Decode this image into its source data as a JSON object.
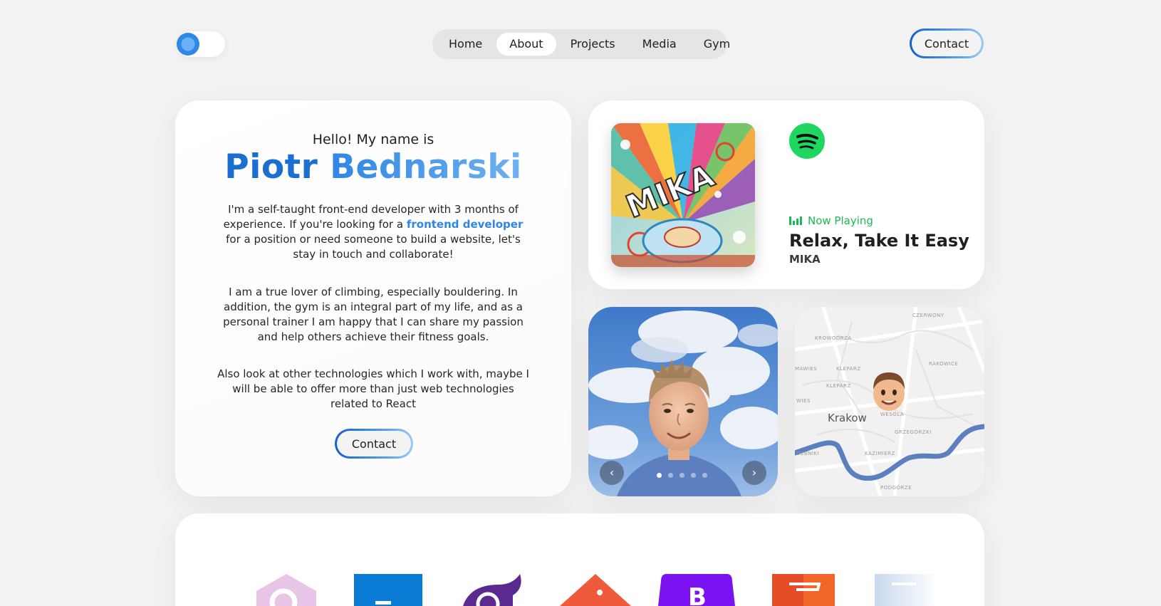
{
  "header": {
    "nav": [
      "Home",
      "About",
      "Projects",
      "Media",
      "Gym"
    ],
    "active_nav": "About",
    "contact_label": "Contact"
  },
  "intro": {
    "greeting": "Hello! My name is",
    "first_name": "Piotr",
    "last_name": "Bednarski",
    "p1_before": "I'm a self-taught front-end developer with 3 months of experience. If you're looking for a ",
    "p1_highlight": "frontend developer",
    "p1_after": " for a position or need someone to build a website, let's stay in touch and collaborate!",
    "p2": "I am a true lover of climbing, especially bouldering. In addition, the gym is an integral part of my life, and as a personal trainer I am happy that I can share my passion and help others achieve their fitness goals.",
    "p3": "Also look at other technologies which I work with, maybe I will be able to offer more than just web technologies related to React",
    "contact_label": "Contact"
  },
  "spotify": {
    "status": "Now Playing",
    "song": "Relax, Take It Easy",
    "artist": "MIKA",
    "album_text": "MIKA",
    "brand_color": "#1ed760"
  },
  "photo": {
    "prev_icon": "chevron-left-icon",
    "next_icon": "chevron-right-icon",
    "slide_count": 5,
    "active_slide": 1
  },
  "map": {
    "city": "Krakow",
    "districts": [
      "CZERWONY",
      "KROWODRZA",
      "KLEPARZ",
      "RAKOWICE",
      "KLEPARZ",
      "WIES",
      "MAWIES",
      "WESOLA",
      "GRZEGÓRZKI",
      "KAZIMIERZ",
      "DEBNIKI",
      "PODGÓRZE"
    ]
  },
  "colors": {
    "accent": "#1a6fd1",
    "accent_light": "#6fb1f0",
    "background": "#f2f2f2",
    "spotify_green": "#1db954"
  }
}
